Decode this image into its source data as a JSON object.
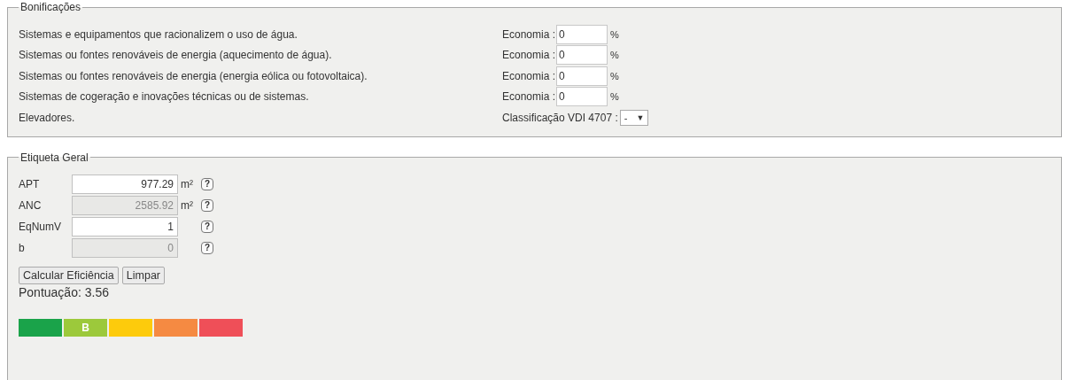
{
  "bonificacoes": {
    "legend": "Bonificações",
    "items": [
      {
        "kind": "percent",
        "label": "Sistemas e equipamentos que racionalizem o uso de água.",
        "field_label": "Economia :",
        "value": "0",
        "unit": "%"
      },
      {
        "kind": "percent",
        "label": "Sistemas ou fontes renováveis de energia (aquecimento de água).",
        "field_label": "Economia :",
        "value": "0",
        "unit": "%"
      },
      {
        "kind": "percent",
        "label": "Sistemas ou fontes renováveis de energia (energia eólica ou fotovoltaica).",
        "field_label": "Economia :",
        "value": "0",
        "unit": "%"
      },
      {
        "kind": "percent",
        "label": "Sistemas de cogeração e inovações técnicas ou de sistemas.",
        "field_label": "Economia :",
        "value": "0",
        "unit": "%"
      },
      {
        "kind": "select",
        "label": "Elevadores.",
        "field_label": "Classificação VDI 4707 :",
        "value": "-",
        "caret": "▼"
      }
    ]
  },
  "etiqueta": {
    "legend": "Etiqueta Geral",
    "fields": [
      {
        "label": "APT",
        "value": "977.29",
        "unit": "m²",
        "disabled": false,
        "help": "?"
      },
      {
        "label": "ANC",
        "value": "2585.92",
        "unit": "m²",
        "disabled": true,
        "help": "?"
      },
      {
        "label": "EqNumV",
        "value": "1",
        "disabled": false,
        "help": "?"
      },
      {
        "label": "b",
        "value": "0",
        "disabled": true,
        "help": "?"
      }
    ],
    "buttons": [
      "Calcular Eficiência",
      "Limpar"
    ],
    "score": "Pontuação: 3.56",
    "rating": [
      {
        "color": "#1aa34a"
      },
      {
        "color": "#9cc93b",
        "label": "B"
      },
      {
        "color": "#fdcb0c"
      },
      {
        "color": "#f58a42"
      },
      {
        "color": "#ef4f58"
      }
    ]
  }
}
